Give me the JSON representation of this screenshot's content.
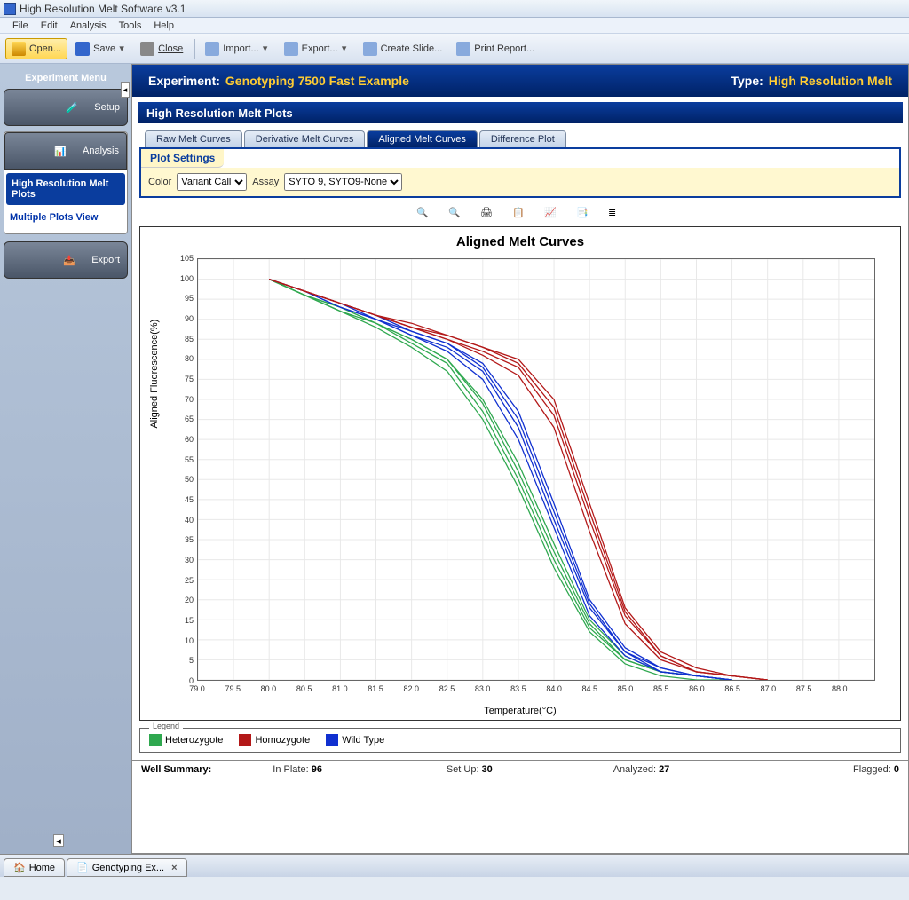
{
  "app": {
    "title": "High Resolution Melt Software v3.1"
  },
  "menus": [
    "File",
    "Edit",
    "Analysis",
    "Tools",
    "Help"
  ],
  "toolbar": {
    "open": "Open...",
    "save": "Save",
    "close": "Close",
    "import": "Import...",
    "export": "Export...",
    "slide": "Create Slide...",
    "print": "Print Report..."
  },
  "sidebar": {
    "header": "Experiment Menu",
    "setup": "Setup",
    "analysis": "Analysis",
    "hrm_plots": "High Resolution Melt Plots",
    "multiple_plots": "Multiple Plots View",
    "export": "Export"
  },
  "experiment": {
    "label": "Experiment:",
    "name": "Genotyping 7500 Fast Example",
    "type_label": "Type:",
    "type_value": "High Resolution Melt"
  },
  "section_title": "High Resolution Melt Plots",
  "tabs": [
    "Raw Melt Curves",
    "Derivative Melt Curves",
    "Aligned Melt Curves",
    "Difference Plot"
  ],
  "active_tab": 2,
  "plot_settings_label": "Plot Settings",
  "filters": {
    "color_label": "Color",
    "color_value": "Variant Call",
    "assay_label": "Assay",
    "assay_value": "SYTO 9, SYTO9-None"
  },
  "chart_title": "Aligned Melt Curves",
  "legend_title": "Legend",
  "legend": [
    {
      "name": "Heterozygote",
      "color": "#2fa84f"
    },
    {
      "name": "Homozygote",
      "color": "#b31818"
    },
    {
      "name": "Wild Type",
      "color": "#1030d0"
    }
  ],
  "summary": {
    "label": "Well Summary:",
    "in_plate_lbl": "In Plate:",
    "in_plate_val": "96",
    "setup_lbl": "Set Up:",
    "setup_val": "30",
    "analyzed_lbl": "Analyzed:",
    "analyzed_val": "27",
    "flagged_lbl": "Flagged:",
    "flagged_val": "0"
  },
  "bottom_tabs": {
    "home": "Home",
    "doc": "Genotyping Ex..."
  },
  "chart_data": {
    "type": "line",
    "title": "Aligned Melt Curves",
    "xlabel": "Temperature(°C)",
    "ylabel": "Aligned Fluorescence(%)",
    "xlim": [
      79.0,
      88.5
    ],
    "ylim": [
      0,
      105
    ],
    "xticks": [
      79.0,
      79.5,
      80.0,
      80.5,
      81.0,
      81.5,
      82.0,
      82.5,
      83.0,
      83.5,
      84.0,
      84.5,
      85.0,
      85.5,
      86.0,
      86.5,
      87.0,
      87.5,
      88.0
    ],
    "yticks": [
      0,
      5,
      10,
      15,
      20,
      25,
      30,
      35,
      40,
      45,
      50,
      55,
      60,
      65,
      70,
      75,
      80,
      85,
      90,
      95,
      100,
      105
    ],
    "series": [
      {
        "name": "Heterozygote",
        "color": "#2fa84f",
        "x": [
          80.0,
          80.5,
          81.0,
          81.5,
          82.0,
          82.5,
          83.0,
          83.5,
          84.0,
          84.5,
          85.0,
          85.5,
          86.0,
          86.5
        ],
        "y": [
          100,
          96,
          92,
          89,
          84,
          79,
          67,
          50,
          30,
          13,
          5,
          2,
          1,
          0
        ]
      },
      {
        "name": "Heterozygote",
        "color": "#2fa84f",
        "x": [
          80.0,
          80.5,
          81.0,
          81.5,
          82.0,
          82.5,
          83.0,
          83.5,
          84.0,
          84.5,
          85.0,
          85.5,
          86.0,
          86.5
        ],
        "y": [
          100,
          96,
          93,
          89,
          85,
          80,
          69,
          52,
          32,
          14,
          5,
          2,
          1,
          0
        ]
      },
      {
        "name": "Heterozygote",
        "color": "#2fa84f",
        "x": [
          80.0,
          80.5,
          81.0,
          81.5,
          82.0,
          82.5,
          83.0,
          83.5,
          84.0,
          84.5,
          85.0,
          85.5,
          86.0,
          86.5
        ],
        "y": [
          100,
          96,
          92,
          88,
          83,
          77,
          65,
          48,
          28,
          12,
          4,
          1,
          0,
          0
        ]
      },
      {
        "name": "Heterozygote",
        "color": "#2fa84f",
        "x": [
          80.0,
          80.5,
          81.0,
          81.5,
          82.0,
          82.5,
          83.0,
          83.5,
          84.0,
          84.5,
          85.0,
          85.5,
          86.0,
          86.5
        ],
        "y": [
          100,
          96,
          93,
          89,
          85,
          80,
          70,
          54,
          34,
          15,
          6,
          2,
          1,
          0
        ]
      },
      {
        "name": "Wild Type",
        "color": "#1030d0",
        "x": [
          80.0,
          80.5,
          81.0,
          81.5,
          82.0,
          82.5,
          83.0,
          83.5,
          84.0,
          84.5,
          85.0,
          85.5,
          86.0,
          86.5
        ],
        "y": [
          100,
          97,
          93,
          90,
          86,
          83,
          77,
          63,
          40,
          18,
          7,
          2,
          1,
          0
        ]
      },
      {
        "name": "Wild Type",
        "color": "#1030d0",
        "x": [
          80.0,
          80.5,
          81.0,
          81.5,
          82.0,
          82.5,
          83.0,
          83.5,
          84.0,
          84.5,
          85.0,
          85.5,
          86.0,
          86.5
        ],
        "y": [
          100,
          97,
          94,
          90,
          87,
          84,
          78,
          65,
          42,
          19,
          7,
          3,
          1,
          0
        ]
      },
      {
        "name": "Wild Type",
        "color": "#1030d0",
        "x": [
          80.0,
          80.5,
          81.0,
          81.5,
          82.0,
          82.5,
          83.0,
          83.5,
          84.0,
          84.5,
          85.0,
          85.5,
          86.0,
          86.5
        ],
        "y": [
          100,
          97,
          93,
          90,
          86,
          82,
          75,
          60,
          38,
          16,
          6,
          2,
          1,
          0
        ]
      },
      {
        "name": "Wild Type",
        "color": "#1030d0",
        "x": [
          80.0,
          80.5,
          81.0,
          81.5,
          82.0,
          82.5,
          83.0,
          83.5,
          84.0,
          84.5,
          85.0,
          85.5,
          86.0,
          86.5
        ],
        "y": [
          100,
          97,
          94,
          91,
          87,
          84,
          79,
          67,
          44,
          20,
          8,
          3,
          1,
          0
        ]
      },
      {
        "name": "Homozygote",
        "color": "#b31818",
        "x": [
          80.0,
          80.5,
          81.0,
          81.5,
          82.0,
          82.5,
          83.0,
          83.5,
          84.0,
          84.5,
          85.0,
          85.5,
          86.0,
          86.5,
          87.0
        ],
        "y": [
          100,
          97,
          94,
          91,
          88,
          85,
          82,
          78,
          66,
          40,
          16,
          6,
          2,
          1,
          0
        ]
      },
      {
        "name": "Homozygote",
        "color": "#b31818",
        "x": [
          80.0,
          80.5,
          81.0,
          81.5,
          82.0,
          82.5,
          83.0,
          83.5,
          84.0,
          84.5,
          85.0,
          85.5,
          86.0,
          86.5,
          87.0
        ],
        "y": [
          100,
          97,
          94,
          91,
          88,
          86,
          83,
          79,
          68,
          42,
          17,
          6,
          2,
          1,
          0
        ]
      },
      {
        "name": "Homozygote",
        "color": "#b31818",
        "x": [
          80.0,
          80.5,
          81.0,
          81.5,
          82.0,
          82.5,
          83.0,
          83.5,
          84.0,
          84.5,
          85.0,
          85.5,
          86.0,
          86.5,
          87.0
        ],
        "y": [
          100,
          97,
          94,
          91,
          88,
          85,
          81,
          76,
          63,
          37,
          14,
          5,
          2,
          1,
          0
        ]
      },
      {
        "name": "Homozygote",
        "color": "#b31818",
        "x": [
          80.0,
          80.5,
          81.0,
          81.5,
          82.0,
          82.5,
          83.0,
          83.5,
          84.0,
          84.5,
          85.0,
          85.5,
          86.0,
          86.5,
          87.0
        ],
        "y": [
          100,
          97,
          94,
          91,
          89,
          86,
          83,
          80,
          70,
          44,
          18,
          7,
          3,
          1,
          0
        ]
      }
    ]
  }
}
